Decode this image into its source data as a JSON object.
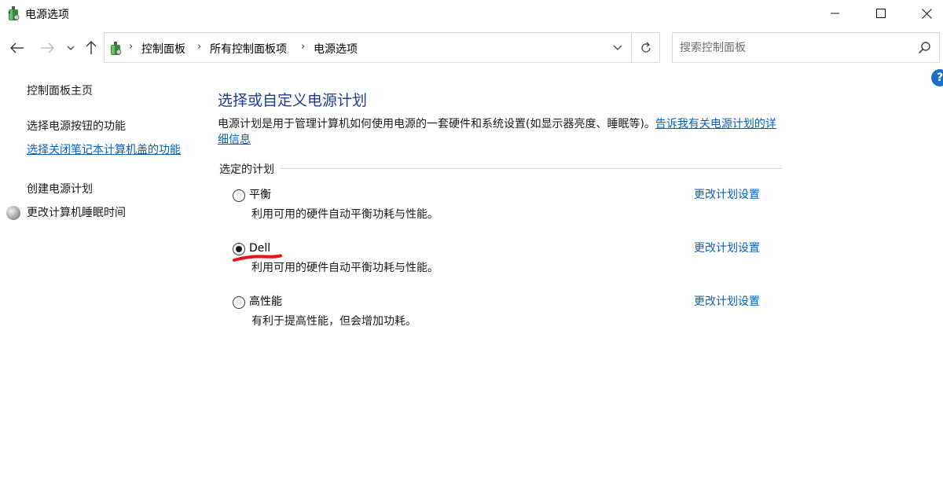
{
  "window": {
    "title": "电源选项",
    "minimize_icon": "minimize-icon",
    "maximize_icon": "maximize-icon",
    "close_icon": "close-icon"
  },
  "navigation": {
    "back_icon": "arrow-left-icon",
    "forward_icon": "arrow-right-icon",
    "recent_icon": "chevron-down-icon",
    "up_icon": "arrow-up-icon",
    "breadcrumb": [
      "控制面板",
      "所有控制面板项",
      "电源选项"
    ],
    "refresh_icon": "refresh-icon"
  },
  "search": {
    "placeholder": "搜索控制面板",
    "value": ""
  },
  "sidebar": {
    "home": "控制面板主页",
    "items": [
      {
        "label": "选择电源按钮的功能"
      },
      {
        "label": "选择关闭笔记本计算机盖的功能"
      },
      {
        "label": "创建电源计划"
      },
      {
        "label": "更改计算机睡眠时间"
      }
    ]
  },
  "main": {
    "title": "选择或自定义电源计划",
    "description": "电源计划是用于管理计算机如何使用电源的一套硬件和系统设置(如显示器亮度、睡眠等)。",
    "description_link": "告诉我有关电源计划的详细信息",
    "group_label": "选定的计划",
    "plans": [
      {
        "name": "平衡",
        "description": "利用可用的硬件自动平衡功耗与性能。",
        "selected": false,
        "link": "更改计划设置"
      },
      {
        "name": "Dell",
        "description": "利用可用的硬件自动平衡功耗与性能。",
        "selected": true,
        "link": "更改计划设置"
      },
      {
        "name": "高性能",
        "description": "有利于提高性能，但会增加功耗。",
        "selected": false,
        "link": "更改计划设置"
      }
    ]
  },
  "colors": {
    "link": "#0a5fb4",
    "heading": "#1e3d8f",
    "annotation_mark": "#e8141c"
  },
  "help": {
    "label": "?"
  }
}
